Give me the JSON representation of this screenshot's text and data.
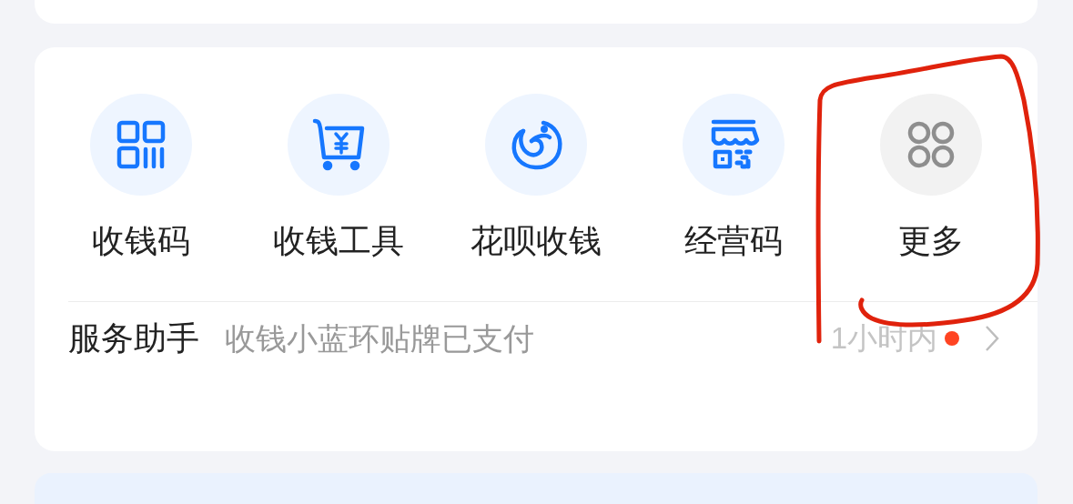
{
  "shortcuts": [
    {
      "label": "收钱码"
    },
    {
      "label": "收钱工具"
    },
    {
      "label": "花呗收钱"
    },
    {
      "label": "经营码"
    },
    {
      "label": "更多"
    }
  ],
  "service": {
    "title": "服务助手",
    "message": "收钱小蓝环贴牌已支付",
    "time": "1小时内",
    "unread": true
  }
}
